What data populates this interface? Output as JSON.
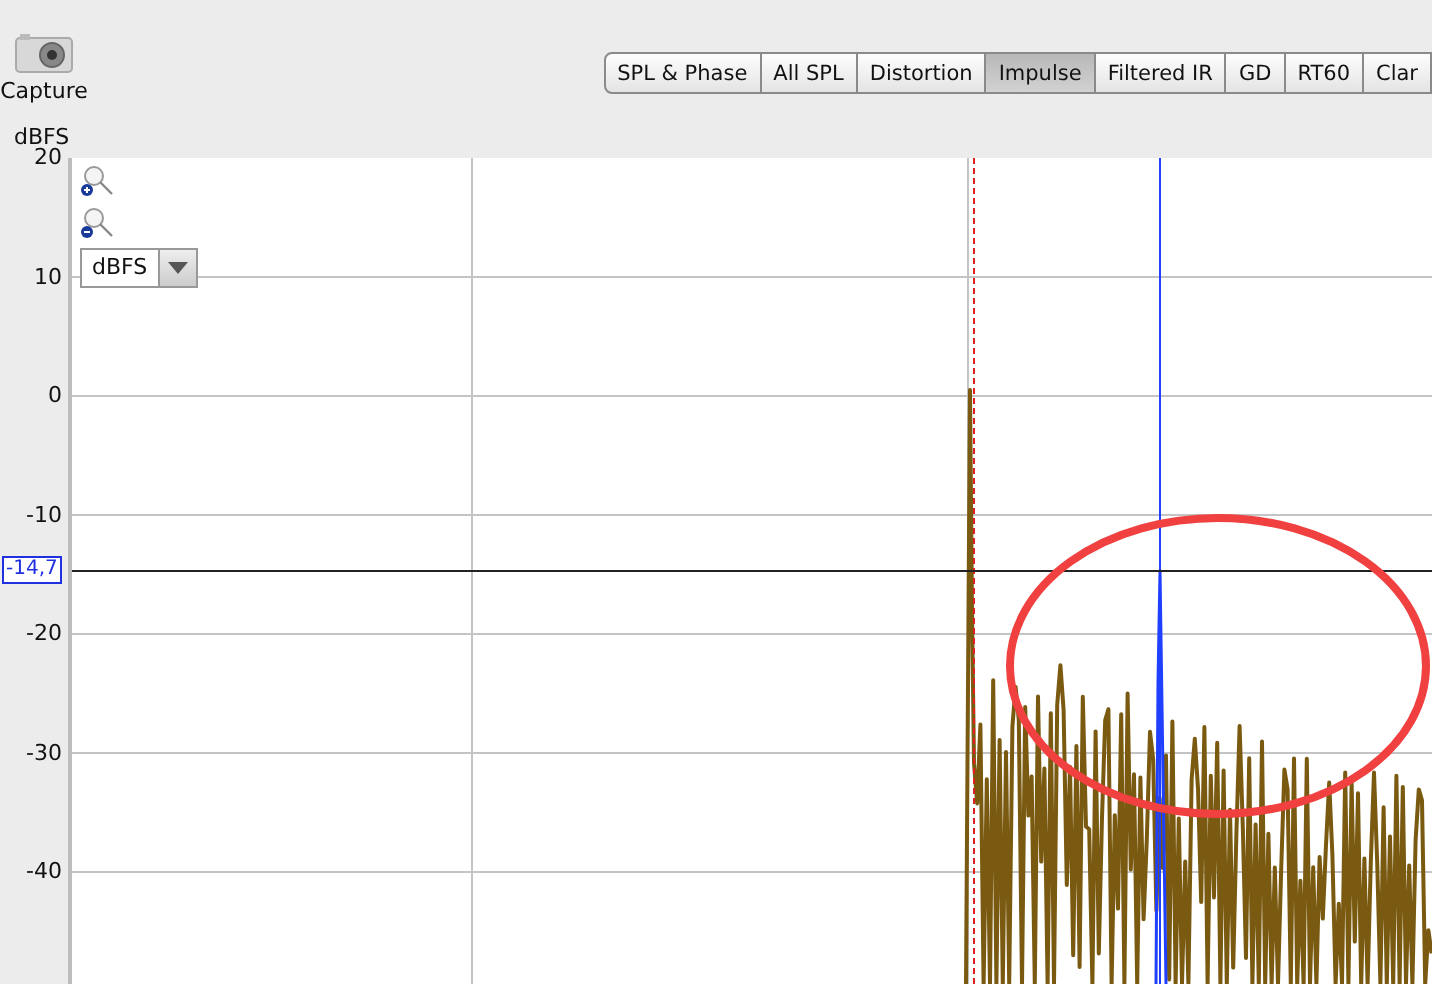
{
  "toolbar": {
    "capture_label": "Capture"
  },
  "tabs": [
    {
      "label": "SPL & Phase",
      "selected": false
    },
    {
      "label": "All SPL",
      "selected": false
    },
    {
      "label": "Distortion",
      "selected": false
    },
    {
      "label": "Impulse",
      "selected": true
    },
    {
      "label": "Filtered IR",
      "selected": false
    },
    {
      "label": "GD",
      "selected": false
    },
    {
      "label": "RT60",
      "selected": false
    },
    {
      "label": "Clar",
      "selected": false
    }
  ],
  "plot": {
    "y_unit": "dBFS",
    "y_ticks": [
      "20",
      "10",
      "0",
      "-10",
      "-20",
      "-30",
      "-40"
    ],
    "unit_dropdown": {
      "value": "dBFS"
    },
    "cursor_readout": "-14,7"
  }
}
